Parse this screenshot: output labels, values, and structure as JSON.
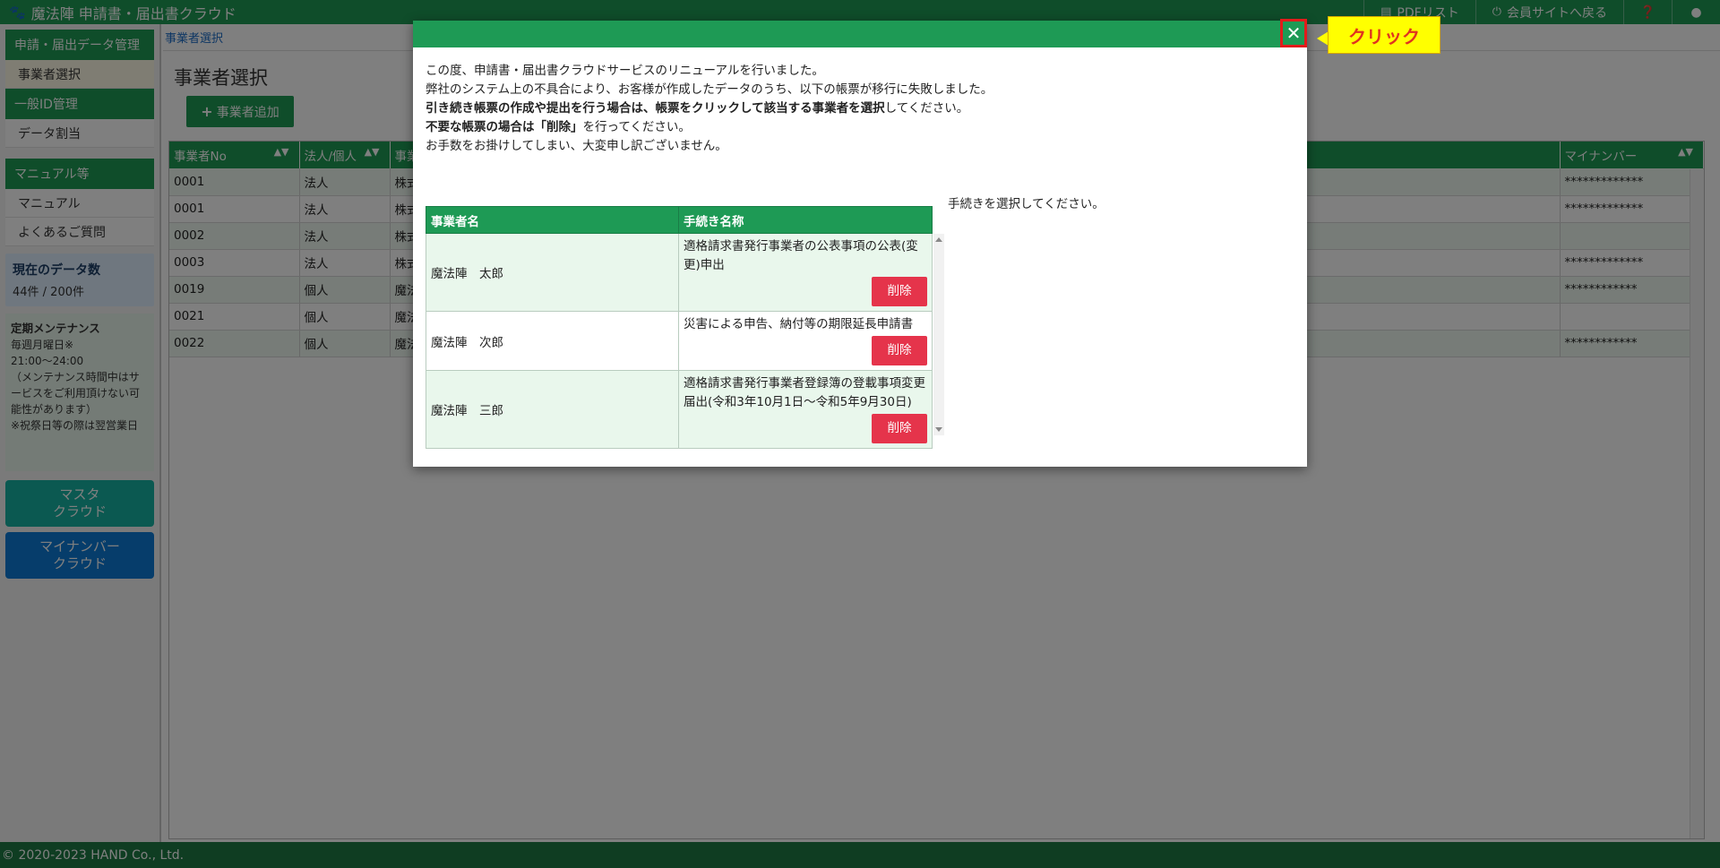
{
  "topbar": {
    "app_title": "魔法陣 申請書・届出書クラウド",
    "pdf_list": "PDFリスト",
    "member_site": "会員サイトへ戻る"
  },
  "sidebar": {
    "sections": [
      {
        "heading": "申請・届出データ管理",
        "items": [
          "事業者選択"
        ]
      },
      {
        "heading": "一般ID管理",
        "items": [
          "データ割当"
        ]
      },
      {
        "heading": "マニュアル等",
        "items": [
          "マニュアル",
          "よくあるご質問"
        ]
      }
    ],
    "data_count_title": "現在のデータ数",
    "data_count_value": "44件 / 200件",
    "maintenance_title": "定期メンテナンス",
    "maintenance_line1": "毎週月曜日※",
    "maintenance_line2": "21:00〜24:00",
    "maintenance_line3": "（メンテナンス時間中はサービスをご利用頂けない可能性があります）",
    "maintenance_line4": "※祝祭日等の際は翌営業日",
    "master_btn_line1": "マスタ",
    "master_btn_line2": "クラウド",
    "mynumber_btn_line1": "マイナンバー",
    "mynumber_btn_line2": "クラウド"
  },
  "main": {
    "breadcrumb": "事業者選択",
    "title": "事業者選択",
    "add_button": "事業者追加",
    "columns": [
      "事業者No",
      "法人/個人",
      "事業",
      "マイナンバー"
    ],
    "rows": [
      {
        "no": "0001",
        "type": "法人",
        "name": "株式",
        "mynumber": "*************"
      },
      {
        "no": "0001",
        "type": "法人",
        "name": "株式",
        "mynumber": "*************"
      },
      {
        "no": "0002",
        "type": "法人",
        "name": "株式",
        "mynumber": ""
      },
      {
        "no": "0003",
        "type": "法人",
        "name": "株式",
        "mynumber": "*************"
      },
      {
        "no": "0019",
        "type": "個人",
        "name": "魔法",
        "mynumber": "************"
      },
      {
        "no": "0021",
        "type": "個人",
        "name": "魔法",
        "mynumber": ""
      },
      {
        "no": "0022",
        "type": "個人",
        "name": "魔法",
        "mynumber": "************"
      }
    ]
  },
  "footer": "© 2020-2023 HAND Co., Ltd.",
  "modal": {
    "line1": "この度、申請書・届出書クラウドサービスのリニューアルを行いました。",
    "line2": "弊社のシステム上の不具合により、お客様が作成したデータのうち、以下の帳票が移行に失敗しました。",
    "line3_bold": "引き続き帳票の作成や提出を行う場合は、帳票をクリックして該当する事業者を選択",
    "line3_rest": "してください。",
    "line4_bold": "不要な帳票の場合は「削除」",
    "line4_rest": "を行ってください。",
    "line5": "お手数をお掛けしてしまい、大変申し訳ございません。",
    "table_headers": [
      "事業者名",
      "手続き名称"
    ],
    "table_rows": [
      {
        "name": "魔法陣　太郎",
        "procedure": "適格請求書発行事業者の公表事項の公表(変更)申出"
      },
      {
        "name": "魔法陣　次郎",
        "procedure": "災害による申告、納付等の期限延長申請書"
      },
      {
        "name": "魔法陣　三郎",
        "procedure": "適格請求書発行事業者登録簿の登載事項変更届出(令和3年10月1日～令和5年9月30日)"
      }
    ],
    "delete_label": "削除",
    "choose_message": "手続きを選択してください。",
    "close_symbol": "✕"
  },
  "callout": "クリック"
}
